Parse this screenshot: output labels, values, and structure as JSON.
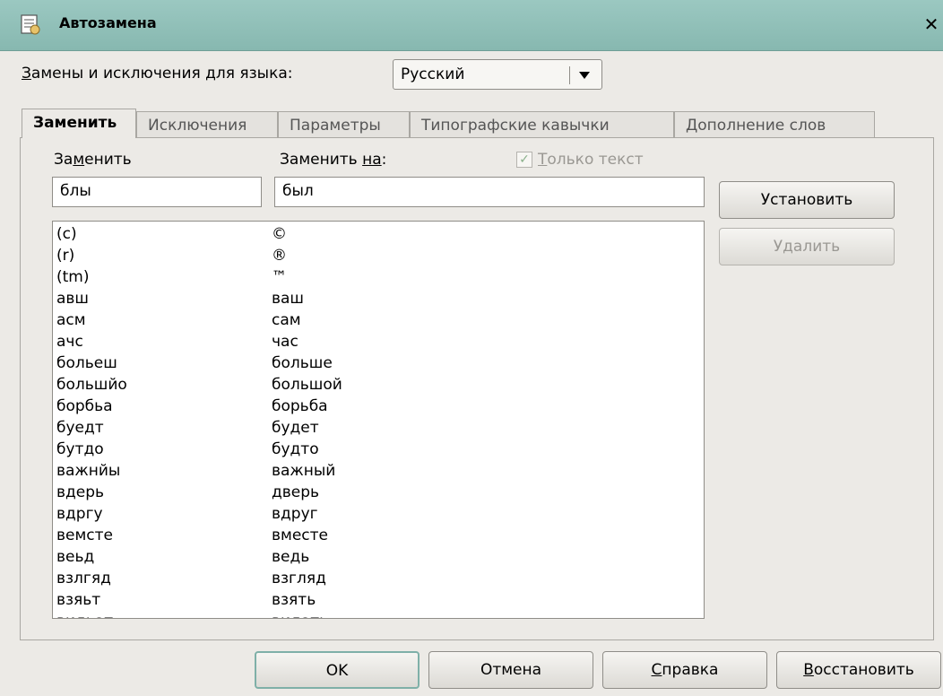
{
  "window": {
    "title": "Автозамена",
    "close_glyph": "✕",
    "icon": "app-document-icon"
  },
  "language": {
    "label_u": "З",
    "label_rest": "амены и исключения для языка:",
    "selected": "Русский"
  },
  "tabs": [
    {
      "label": "Заменить"
    },
    {
      "label": "Исключения"
    },
    {
      "label": "Параметры"
    },
    {
      "label": "Типографские кавычки"
    },
    {
      "label": "Дополнение слов"
    }
  ],
  "replace": {
    "label_a": "За",
    "label_u": "м",
    "label_b": "енить",
    "with_a": "Заменить ",
    "with_u": "на",
    "with_b": ":",
    "text_only_u": "Т",
    "text_only_rest": "олько текст",
    "value": "блы",
    "with_value": "был"
  },
  "buttons": {
    "install": "Установить",
    "delete_a": "У",
    "delete_u": "д",
    "delete_b": "алить",
    "ok": "OK",
    "cancel": "Отмена",
    "help_u": "С",
    "help_rest": "правка",
    "restore_u": "В",
    "restore_rest": "осстановить"
  },
  "list": {
    "rows": [
      {
        "from": "(c)",
        "to": "©"
      },
      {
        "from": "(r)",
        "to": "®"
      },
      {
        "from": "(tm)",
        "to": "™"
      },
      {
        "from": "авш",
        "to": "ваш"
      },
      {
        "from": "асм",
        "to": "сам"
      },
      {
        "from": "ачс",
        "to": "час"
      },
      {
        "from": "больеш",
        "to": "больше"
      },
      {
        "from": "большйо",
        "to": "большой"
      },
      {
        "from": "борбьа",
        "to": "борьба"
      },
      {
        "from": "буедт",
        "to": "будет"
      },
      {
        "from": "бутдо",
        "to": "будто"
      },
      {
        "from": "важнйы",
        "to": "важный"
      },
      {
        "from": "вдерь",
        "to": "дверь"
      },
      {
        "from": "вдргу",
        "to": "вдруг"
      },
      {
        "from": "вемсте",
        "to": "вместе"
      },
      {
        "from": "веьд",
        "to": "ведь"
      },
      {
        "from": "взлгяд",
        "to": "взгляд"
      },
      {
        "from": "взяьт",
        "to": "взять"
      },
      {
        "from": "видьат",
        "to": "видать"
      }
    ]
  }
}
